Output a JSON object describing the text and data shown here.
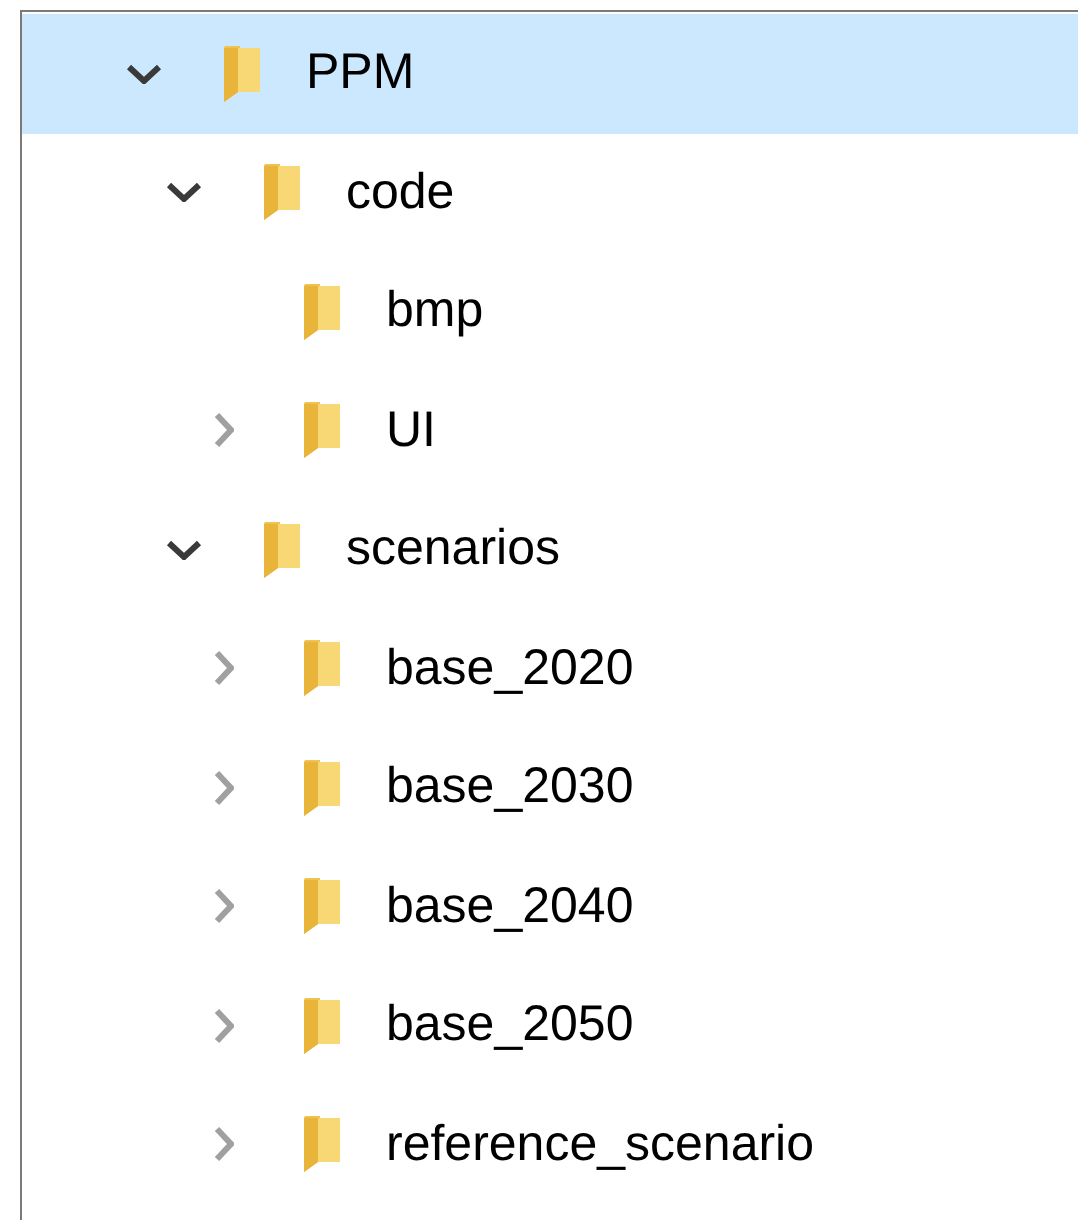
{
  "tree": [
    {
      "label": "PPM",
      "kind": "expandable",
      "expanded": true,
      "selected": true,
      "children": [
        {
          "label": "code",
          "kind": "expandable",
          "expanded": true,
          "selected": false,
          "children": [
            {
              "label": "bmp",
              "kind": "leaf",
              "selected": false
            },
            {
              "label": "UI",
              "kind": "expandable",
              "expanded": false,
              "selected": false
            }
          ]
        },
        {
          "label": "scenarios",
          "kind": "expandable",
          "expanded": true,
          "selected": false,
          "children": [
            {
              "label": "base_2020",
              "kind": "expandable",
              "expanded": false,
              "selected": false
            },
            {
              "label": "base_2030",
              "kind": "expandable",
              "expanded": false,
              "selected": false
            },
            {
              "label": "base_2040",
              "kind": "expandable",
              "expanded": false,
              "selected": false
            },
            {
              "label": "base_2050",
              "kind": "expandable",
              "expanded": false,
              "selected": false
            },
            {
              "label": "reference_scenario",
              "kind": "expandable",
              "expanded": false,
              "selected": false
            }
          ]
        }
      ]
    }
  ]
}
